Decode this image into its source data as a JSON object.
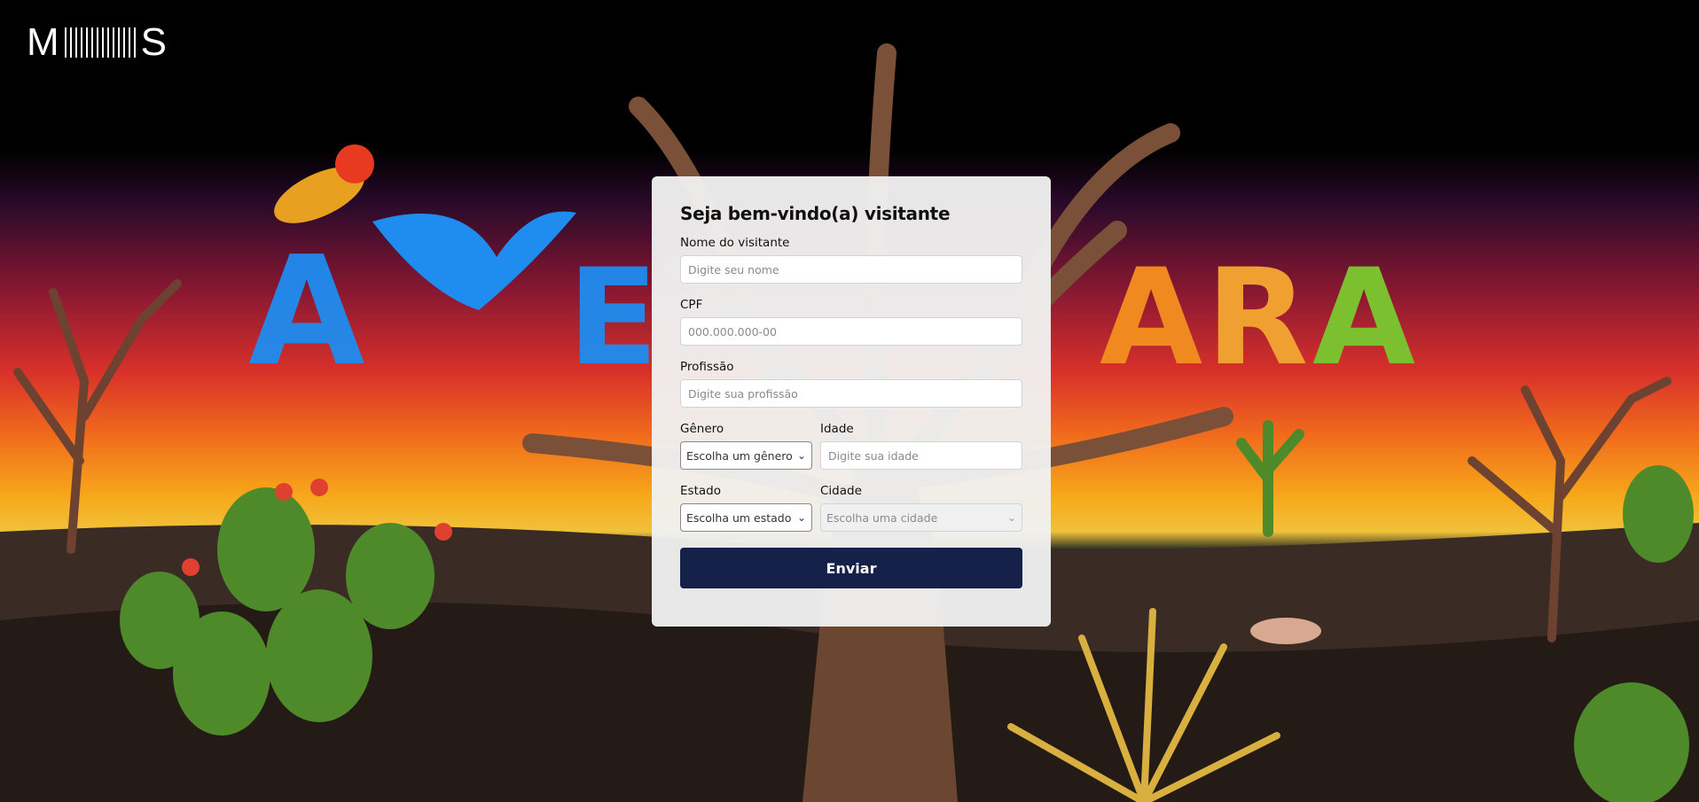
{
  "brand": {
    "letter_left": "M",
    "letter_right": "S",
    "logo_icon": "barcode-logo-icon"
  },
  "form": {
    "title": "Seja bem-vindo(a) visitante",
    "name": {
      "label": "Nome do visitante",
      "placeholder": "Digite seu nome",
      "value": ""
    },
    "cpf": {
      "label": "CPF",
      "placeholder": "000.000.000-00",
      "value": ""
    },
    "profession": {
      "label": "Profissão",
      "placeholder": "Digite sua profissão",
      "value": ""
    },
    "gender": {
      "label": "Gênero",
      "selected": "Escolha um gênero"
    },
    "age": {
      "label": "Idade",
      "placeholder": "Digite sua idade",
      "value": ""
    },
    "state": {
      "label": "Estado",
      "selected": "Escolha um estado"
    },
    "city": {
      "label": "Cidade",
      "selected": "Escolha uma cidade",
      "disabled": true
    },
    "submit_label": "Enviar"
  },
  "colors": {
    "submit_bg": "#16214a",
    "card_bg": "#f0f0f0"
  }
}
